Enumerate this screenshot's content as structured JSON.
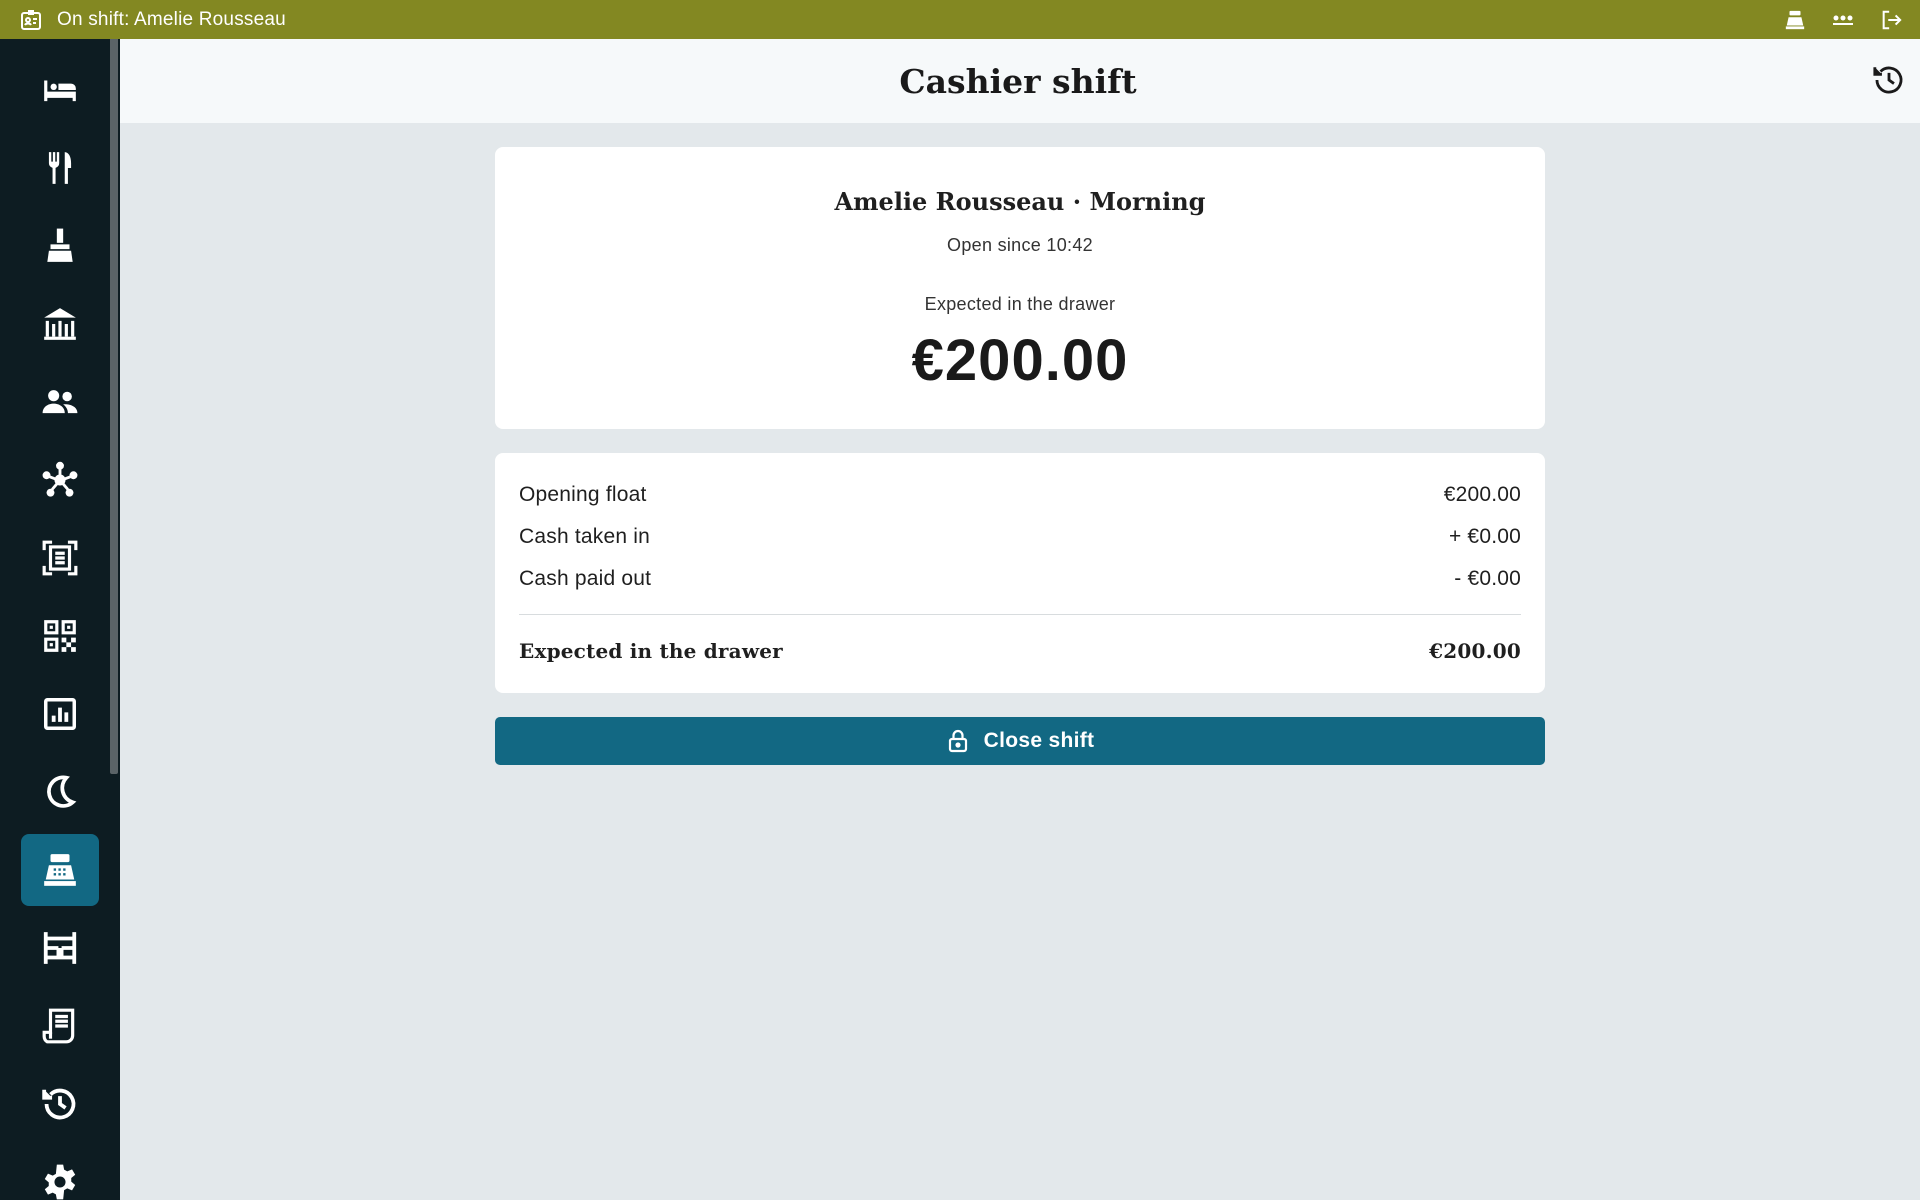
{
  "topbar": {
    "shift_label": "On shift: Amelie Rousseau",
    "icons": [
      "id-badge-icon",
      "cash-register-icon",
      "more-icon",
      "logout-icon"
    ],
    "color": "#838822"
  },
  "sidebar": {
    "items": [
      {
        "icon": "bed-icon",
        "active": false
      },
      {
        "icon": "restaurant-icon",
        "active": false
      },
      {
        "icon": "housekeeping-icon",
        "active": false
      },
      {
        "icon": "facility-icon",
        "active": false
      },
      {
        "icon": "guests-icon",
        "active": false
      },
      {
        "icon": "network-icon",
        "active": false
      },
      {
        "icon": "document-scan-icon",
        "active": false
      },
      {
        "icon": "qr-code-icon",
        "active": false
      },
      {
        "icon": "report-icon",
        "active": false
      },
      {
        "icon": "night-audit-icon",
        "active": false
      },
      {
        "icon": "cash-register-icon",
        "active": true
      },
      {
        "icon": "floor-plan-icon",
        "active": false
      },
      {
        "icon": "invoice-icon",
        "active": false
      },
      {
        "icon": "history-icon",
        "active": false
      },
      {
        "icon": "settings-icon",
        "active": false
      }
    ],
    "background": "#0d1c22",
    "active_color": "#126883"
  },
  "header": {
    "title": "Cashier shift",
    "history_icon": "history-icon"
  },
  "summary": {
    "name": "Amelie Rousseau · Morning",
    "since": "Open since 10:42",
    "expected_label": "Expected in the drawer",
    "expected_amount": "€200.00"
  },
  "ledger": {
    "rows": [
      {
        "label": "Opening float",
        "value": "€200.00"
      },
      {
        "label": "Cash taken in",
        "value": "+ €0.00"
      },
      {
        "label": "Cash paid out",
        "value": "- €0.00"
      }
    ],
    "total": {
      "label": "Expected in the drawer",
      "value": "€200.00"
    }
  },
  "actions": {
    "close_shift_label": "Close shift",
    "close_shift_icon": "lock-icon",
    "button_color": "#126883"
  }
}
